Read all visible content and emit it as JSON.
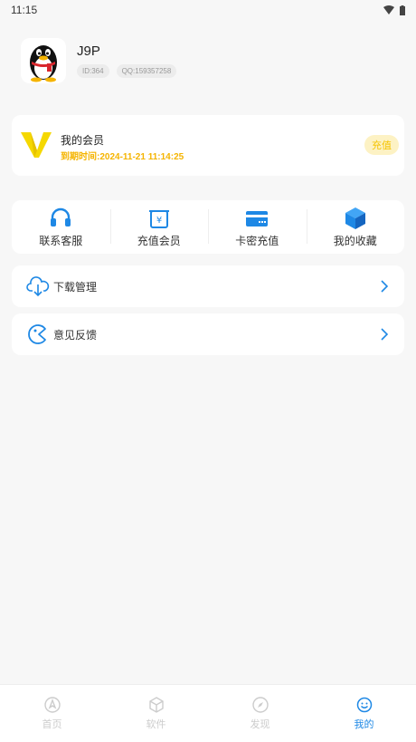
{
  "status_bar": {
    "time": "11:15"
  },
  "profile": {
    "name": "J9P",
    "id_badge": "ID:364",
    "qq_badge": "QQ:159357258"
  },
  "member": {
    "title": "我的会员",
    "expire": "到期时间:2024-11-21 11:14:25",
    "recharge_label": "充值"
  },
  "quick_actions": [
    {
      "label": "联系客服",
      "icon": "headset-icon"
    },
    {
      "label": "充值会员",
      "icon": "recharge-icon"
    },
    {
      "label": "卡密充值",
      "icon": "card-icon"
    },
    {
      "label": "我的收藏",
      "icon": "box-icon"
    }
  ],
  "rows": {
    "download": {
      "label": "下载管理",
      "icon": "cloud-download-icon"
    },
    "feedback": {
      "label": "意见反馈",
      "icon": "feedback-icon"
    }
  },
  "tabs": [
    {
      "label": "首页",
      "icon": "home-icon"
    },
    {
      "label": "软件",
      "icon": "cube-icon"
    },
    {
      "label": "发现",
      "icon": "compass-icon"
    },
    {
      "label": "我的",
      "icon": "smile-icon"
    }
  ],
  "colors": {
    "accent": "#1e88e5",
    "gold": "#f5b400",
    "background": "#f7f7f7"
  }
}
